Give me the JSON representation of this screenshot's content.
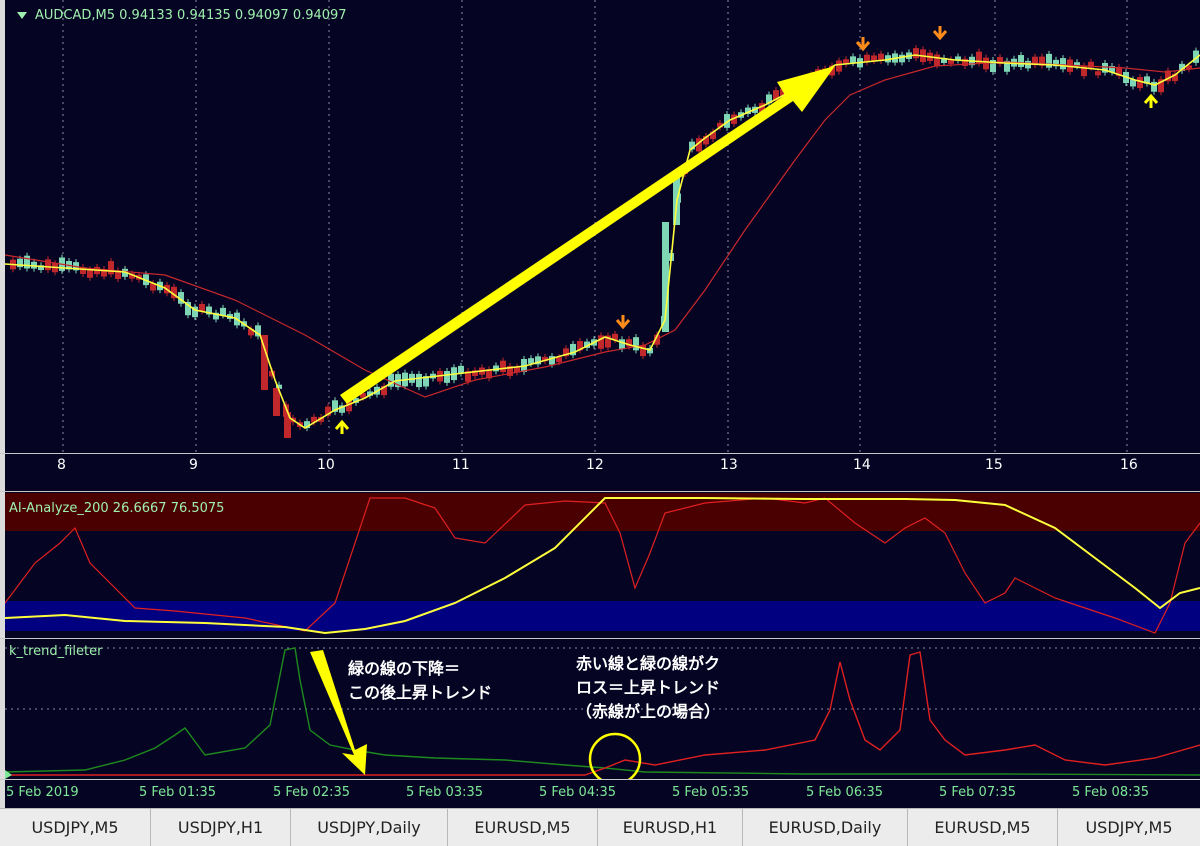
{
  "main_chart": {
    "symbol_line": "AUDCAD,M5  0.94133 0.94135 0.94097 0.94097",
    "date_ticks": [
      "8",
      "9",
      "10",
      "11",
      "12",
      "13",
      "14",
      "15",
      "16"
    ],
    "colors": {
      "bull": "#7fd6b4",
      "bear": "#c0282c",
      "fast_ma": "#ffff3c",
      "slow_ma": "#c8282c",
      "arrow": "#ffff00",
      "down_signal": "#ff8c1a",
      "up_signal": "#ffff00"
    }
  },
  "ai_indicator": {
    "label": "AI-Analyze_200 26.6667 76.5075",
    "colors": {
      "upper_band": "#4a0000",
      "lower_band": "#000080",
      "yellow_line": "#ffff3c",
      "red_line": "#e02020"
    }
  },
  "trend_indicator": {
    "label": "k_trend_fileter",
    "colors": {
      "green_line": "#1e8a1e",
      "red_line": "#e02020"
    }
  },
  "annotations": {
    "green_drop_line1": "緑の線の下降＝",
    "green_drop_line2": "この後上昇トレンド",
    "cross_line1": "赤い線と緑の線がク",
    "cross_line2": "ロス＝上昇トレンド",
    "cross_line3": "（赤線が上の場合）"
  },
  "time_axis": [
    "5 Feb 2019",
    "5 Feb 01:35",
    "5 Feb 02:35",
    "5 Feb 03:35",
    "5 Feb 04:35",
    "5 Feb 05:35",
    "5 Feb 06:35",
    "5 Feb 07:35",
    "5 Feb 08:35"
  ],
  "tabs": [
    "USDJPY,M5",
    "USDJPY,H1",
    "USDJPY,Daily",
    "EURUSD,M5",
    "EURUSD,H1",
    "EURUSD,Daily",
    "EURUSD,M5",
    "USDJPY,M5"
  ]
}
